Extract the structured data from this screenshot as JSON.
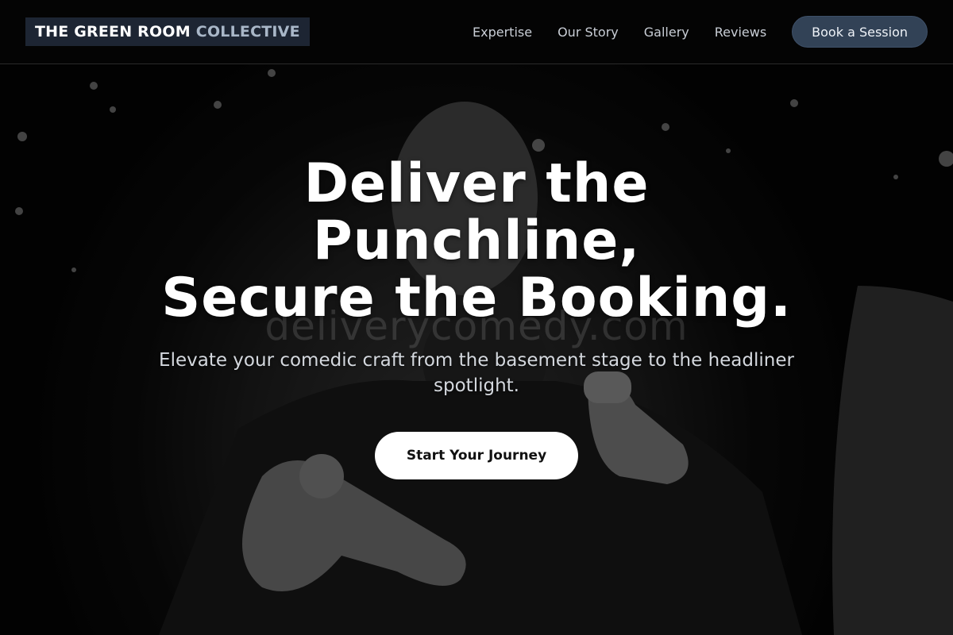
{
  "brand": {
    "name_primary": "THE GREEN ROOM",
    "name_secondary": "COLLECTIVE"
  },
  "nav": {
    "links": [
      "Expertise",
      "Our Story",
      "Gallery",
      "Reviews"
    ],
    "cta_label": "Book a Session"
  },
  "hero": {
    "headline_lines": [
      "Deliver the",
      "Punchline,",
      "Secure the Booking."
    ],
    "subheadline": "Elevate your comedic craft from the basement stage to the headliner spotlight.",
    "cta_label": "Start Your Journey",
    "watermark": "deliverycomedy.com",
    "image_subject": "black-and-white photo of a performer pointing toward the camera"
  },
  "colors": {
    "nav_bg": "#040404",
    "logo_bg": "#1d2533",
    "logo_accent": "#a9b7c8",
    "nav_cta_bg": "#324256",
    "hero_cta_bg": "#ffffff"
  }
}
